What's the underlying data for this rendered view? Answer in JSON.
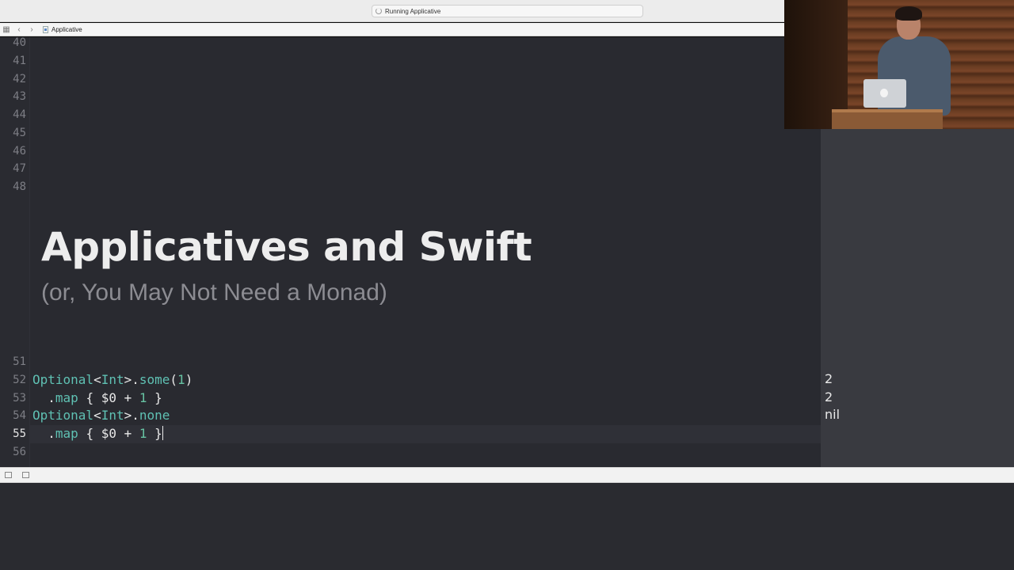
{
  "titlebar": {
    "activity_text": "Running Applicative"
  },
  "jumpbar": {
    "icons": [
      "grid-icon",
      "chevron-left-icon",
      "chevron-right-icon",
      "playground-file-icon"
    ],
    "file_label": "Applicative"
  },
  "editor": {
    "line_numbers": {
      "l40": "40",
      "l41": "41",
      "l42": "42",
      "l43": "43",
      "l44": "44",
      "l45": "45",
      "l46": "46",
      "l47": "47",
      "l48": "48",
      "l51": "51",
      "l52": "52",
      "l53": "53",
      "l54": "54",
      "l55": "55",
      "l56": "56"
    },
    "current_line": "55",
    "markup_title": "Applicatives and Swift",
    "markup_subtitle": "(or, You May Not Need a Monad)",
    "code": {
      "line52": {
        "type": "Optional",
        "lt": "<",
        "generic": "Int",
        "gt": ">.",
        "member": "some",
        "open": "(",
        "num": "1",
        "close": ")"
      },
      "line53": {
        "indent": "  ",
        "dot": ".",
        "member": "map",
        "open": " { $0 + ",
        "num": "1",
        "close": " }"
      },
      "line54": {
        "type": "Optional",
        "lt": "<",
        "generic": "Int",
        "gt": ">.",
        "member": "none"
      },
      "line55": {
        "indent": "  ",
        "dot": ".",
        "member": "map",
        "open": " { $0 + ",
        "num": "1",
        "close": " }"
      }
    }
  },
  "results": {
    "r52": "2",
    "r53": "2",
    "r54": "nil"
  },
  "camera": {
    "description_icon": "presenter-video-feed-icon"
  },
  "debug_area": {
    "icons": [
      "hide-debug-area-icon",
      "console-toggle-icon"
    ]
  },
  "colors": {
    "editor_background": "#292a30",
    "code_type": "#5fc1b3",
    "code_number": "#67c3a3",
    "results_background": "#393a40"
  }
}
